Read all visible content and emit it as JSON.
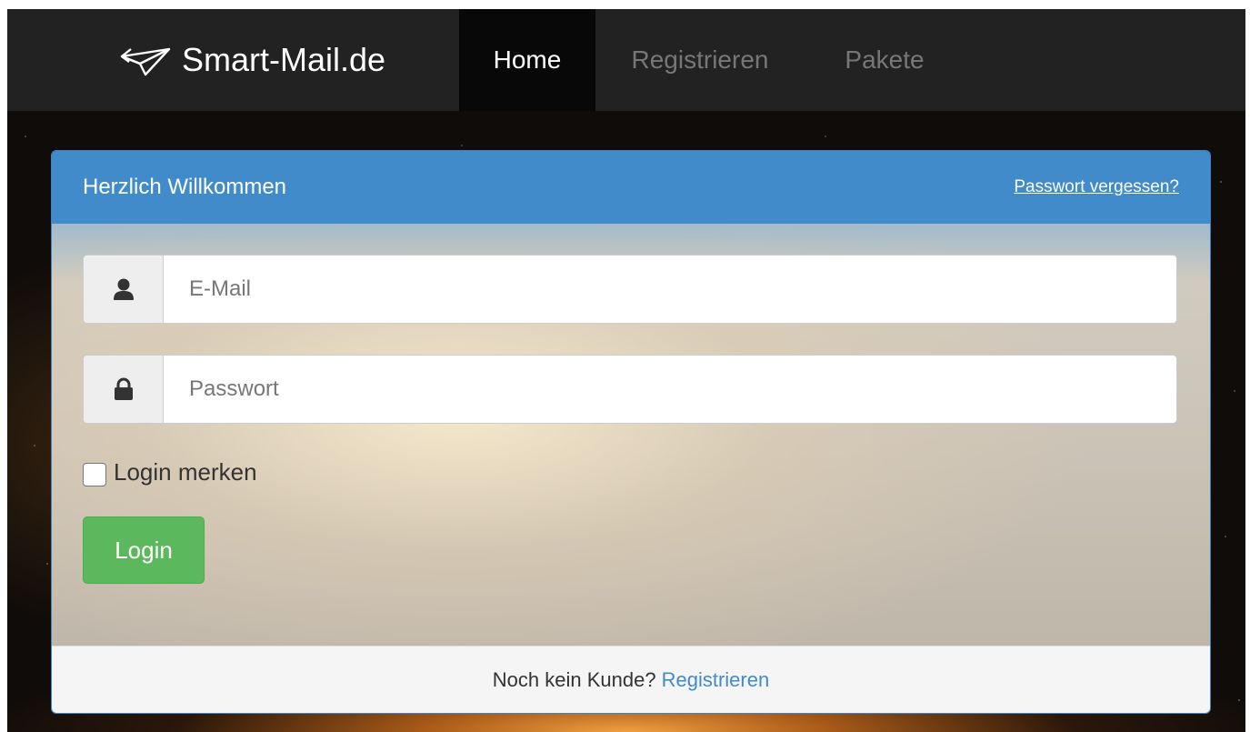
{
  "navbar": {
    "brand": "Smart-Mail.de",
    "brand_icon": "paper-plane-icon",
    "items": [
      {
        "label": "Home",
        "active": true
      },
      {
        "label": "Registrieren",
        "active": false
      },
      {
        "label": "Pakete",
        "active": false
      }
    ]
  },
  "panel": {
    "title": "Herzlich Willkommen",
    "forgot_link": "Passwort vergessen?",
    "email": {
      "placeholder": "E-Mail",
      "value": "",
      "icon": "user-icon"
    },
    "password": {
      "placeholder": "Passwort",
      "value": "",
      "icon": "lock-icon"
    },
    "remember_label": "Login merken",
    "remember_checked": false,
    "login_button": "Login",
    "footer_text": "Noch kein Kunde?",
    "footer_link": "Registrieren"
  },
  "colors": {
    "navbar_bg": "#222222",
    "panel_heading": "#428bca",
    "login_button": "#5cb85c",
    "link": "#428bca"
  }
}
